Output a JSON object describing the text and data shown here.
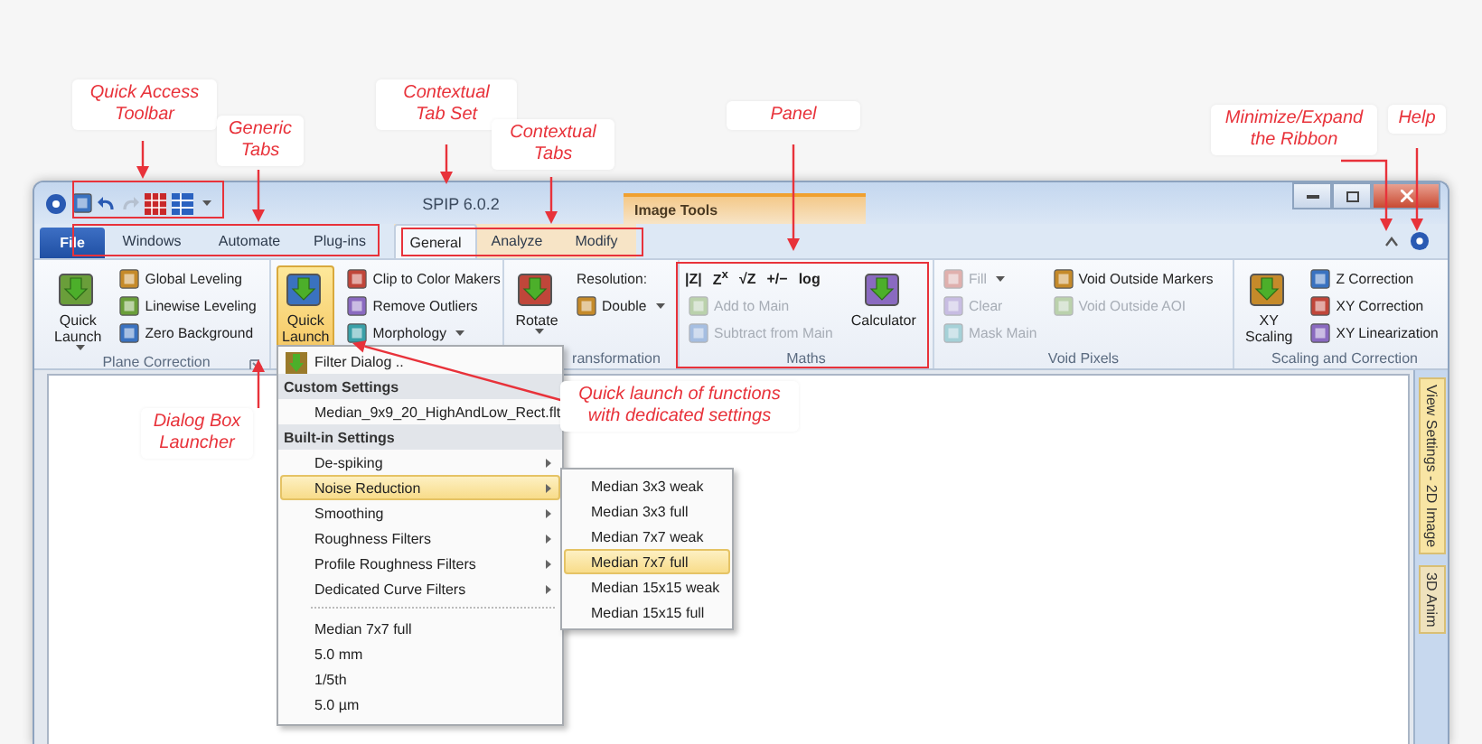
{
  "window": {
    "title": "SPIP 6.0.2",
    "contextual_set": "Image Tools"
  },
  "tabs": [
    {
      "label": "File",
      "kind": "file",
      "selected": false
    },
    {
      "label": "Windows",
      "kind": "generic",
      "selected": false
    },
    {
      "label": "Automate",
      "kind": "generic",
      "selected": false
    },
    {
      "label": "Plug-ins",
      "kind": "generic",
      "selected": false
    },
    {
      "label": "General",
      "kind": "contextual",
      "selected": true
    },
    {
      "label": "Analyze",
      "kind": "contextual",
      "selected": false
    },
    {
      "label": "Modify",
      "kind": "contextual",
      "selected": false
    }
  ],
  "ribbon_groups": [
    {
      "title": "Plane Correction",
      "launcher": true,
      "controls": [
        {
          "kind": "large",
          "label": [
            "Quick",
            "Launch"
          ],
          "dropdown": true,
          "selected": false
        },
        {
          "kind": "stack",
          "items": [
            {
              "label": "Global Leveling",
              "disabled": false
            },
            {
              "label": "Linewise Leveling",
              "disabled": false
            },
            {
              "label": "Zero Background",
              "disabled": false
            }
          ]
        }
      ]
    },
    {
      "controls": [
        {
          "kind": "large",
          "label": [
            "Quick",
            "Launch"
          ],
          "dropdown": true,
          "selected": true
        },
        {
          "kind": "stack",
          "items": [
            {
              "label": "Clip to Color Makers",
              "disabled": false
            },
            {
              "label": "Remove Outliers",
              "disabled": false
            },
            {
              "label": "Morphology",
              "disabled": false,
              "dropdown": true
            }
          ]
        }
      ]
    },
    {
      "title": "ransformation",
      "controls": [
        {
          "kind": "large",
          "label": [
            "Rotate"
          ],
          "dropdown": true,
          "selected": false
        },
        {
          "kind": "stack",
          "items": [
            {
              "label": "Resolution:",
              "disabled": false,
              "icon": false
            },
            {
              "label": "Double",
              "disabled": false,
              "dropdown": true
            }
          ]
        }
      ]
    },
    {
      "title": "Maths",
      "controls": [
        {
          "kind": "stack",
          "symbols": [
            "|Z|",
            "Z$^{x}$",
            "√Z",
            "+/−",
            "log"
          ],
          "items": [
            {
              "label": "Add to Main",
              "disabled": true
            },
            {
              "label": "Subtract from Main",
              "disabled": true
            }
          ]
        },
        {
          "kind": "large",
          "label": [
            "Calculator"
          ],
          "dropdown": false,
          "selected": false
        }
      ]
    },
    {
      "title": "Void Pixels",
      "controls": [
        {
          "kind": "stack",
          "items": [
            {
              "label": "Fill",
              "disabled": true,
              "dropdown": true
            },
            {
              "label": "Clear",
              "disabled": true
            },
            {
              "label": "Mask Main",
              "disabled": true
            }
          ]
        },
        {
          "kind": "stack",
          "items": [
            {
              "label": "Void Outside Markers",
              "disabled": false
            },
            {
              "label": "Void Outside AOI",
              "disabled": true
            }
          ]
        }
      ]
    },
    {
      "title": "Scaling and Correction",
      "controls": [
        {
          "kind": "large",
          "label": [
            "XY",
            "Scaling"
          ],
          "dropdown": false,
          "selected": false
        },
        {
          "kind": "stack",
          "items": [
            {
              "label": "Z Correction",
              "disabled": false
            },
            {
              "label": "XY Correction",
              "disabled": false
            },
            {
              "label": "XY Linearization",
              "disabled": false
            }
          ]
        }
      ]
    }
  ],
  "quick_launch_menu": {
    "items": [
      {
        "kind": "item",
        "label": "Filter Dialog ..",
        "icon": true,
        "selected": false
      },
      {
        "kind": "header",
        "label": "Custom Settings"
      },
      {
        "kind": "item",
        "label": "Median_9x9_20_HighAndLow_Rect.flt",
        "selected": false
      },
      {
        "kind": "header",
        "label": "Built-in Settings"
      },
      {
        "kind": "submenu",
        "label": "De-spiking",
        "selected": false
      },
      {
        "kind": "submenu",
        "label": "Noise Reduction",
        "selected": true
      },
      {
        "kind": "submenu",
        "label": "Smoothing",
        "selected": false
      },
      {
        "kind": "submenu",
        "label": "Roughness Filters",
        "selected": false
      },
      {
        "kind": "submenu",
        "label": "Profile Roughness Filters",
        "selected": false
      },
      {
        "kind": "submenu",
        "label": "Dedicated Curve Filters",
        "selected": false
      },
      {
        "kind": "separator"
      },
      {
        "kind": "item",
        "label": "Median 7x7 full",
        "selected": false
      },
      {
        "kind": "item",
        "label": "5.0 mm",
        "selected": false
      },
      {
        "kind": "item",
        "label": "1/5th",
        "selected": false
      },
      {
        "kind": "item",
        "label": "5.0 µm",
        "selected": false
      }
    ]
  },
  "submenu": {
    "items": [
      {
        "label": "Median 3x3 weak",
        "selected": false
      },
      {
        "label": "Median 3x3 full",
        "selected": false
      },
      {
        "label": "Median 7x7 weak",
        "selected": false
      },
      {
        "label": "Median 7x7 full",
        "selected": true
      },
      {
        "label": "Median 15x15 weak",
        "selected": false
      },
      {
        "label": "Median 15x15 full",
        "selected": false
      }
    ]
  },
  "side_panel": {
    "tabs": [
      {
        "label": "View Settings - 2D Image",
        "selected": true
      },
      {
        "label": "3D Anim",
        "selected": false
      }
    ]
  },
  "annotations": [
    {
      "lines": [
        "Quick Access",
        "Toolbar"
      ]
    },
    {
      "lines": [
        "Generic",
        "Tabs"
      ]
    },
    {
      "lines": [
        "Contextual",
        "Tab Set"
      ]
    },
    {
      "lines": [
        "Contextual",
        "Tabs"
      ]
    },
    {
      "lines": [
        "Panel"
      ]
    },
    {
      "lines": [
        "Minimize/Expand",
        "the Ribbon"
      ]
    },
    {
      "lines": [
        "Help"
      ]
    },
    {
      "lines": [
        "Dialog Box",
        "Launcher"
      ]
    },
    {
      "lines": [
        "Quick launch of functions",
        "with dedicated settings"
      ]
    }
  ]
}
